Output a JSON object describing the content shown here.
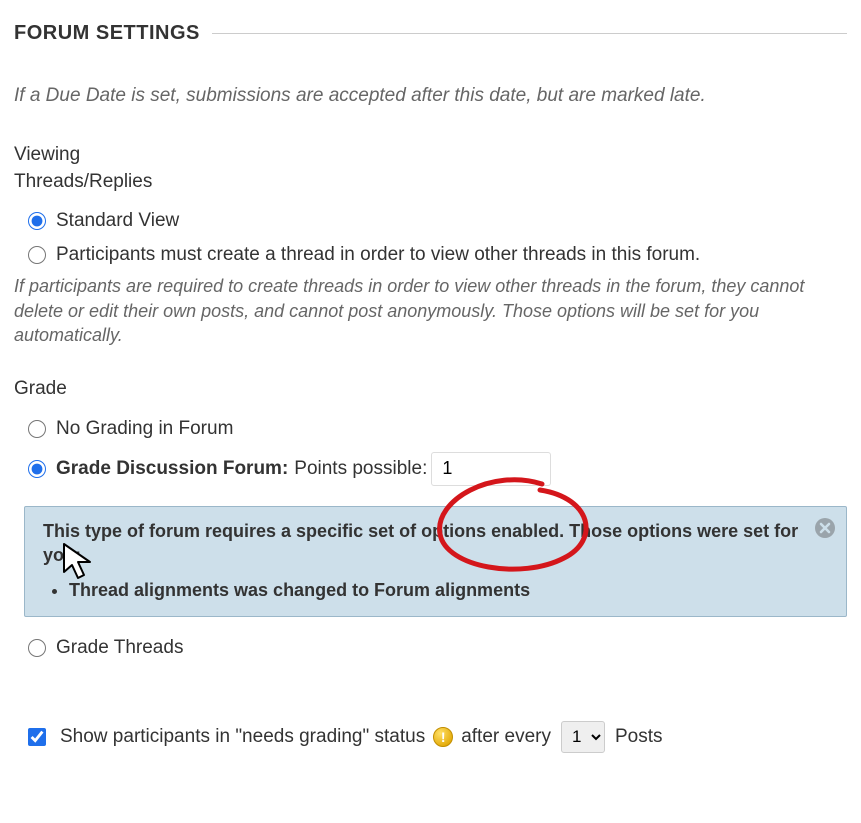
{
  "header": {
    "title": "FORUM SETTINGS"
  },
  "dueDateHint": "If a Due Date is set, submissions are accepted after this date, but are marked late.",
  "viewing": {
    "labelLine1": "Viewing",
    "labelLine2": "Threads/Replies",
    "options": {
      "standard": "Standard View",
      "mustCreate": "Participants must create a thread in order to view other threads in this forum."
    },
    "hint": "If participants are required to create threads in order to view other threads in the forum, they cannot delete or edit their own posts, and cannot post anonymously. Those options will be set for you automatically."
  },
  "grade": {
    "label": "Grade",
    "noGrading": "No Grading in Forum",
    "gradeForumLabel": "Grade Discussion Forum:",
    "pointsPossibleLabel": "Points possible:",
    "pointsValue": "1",
    "gradeThreads": "Grade Threads"
  },
  "infoBox": {
    "title": "This type of forum requires a specific set of options enabled. Those options were set for you:",
    "item1": "Thread alignments was changed to Forum alignments"
  },
  "needsGrading": {
    "prefix": "Show participants in \"needs grading\" status",
    "mid": "after every",
    "selectValue": "1",
    "suffix": "Posts",
    "iconGlyph": "!"
  }
}
